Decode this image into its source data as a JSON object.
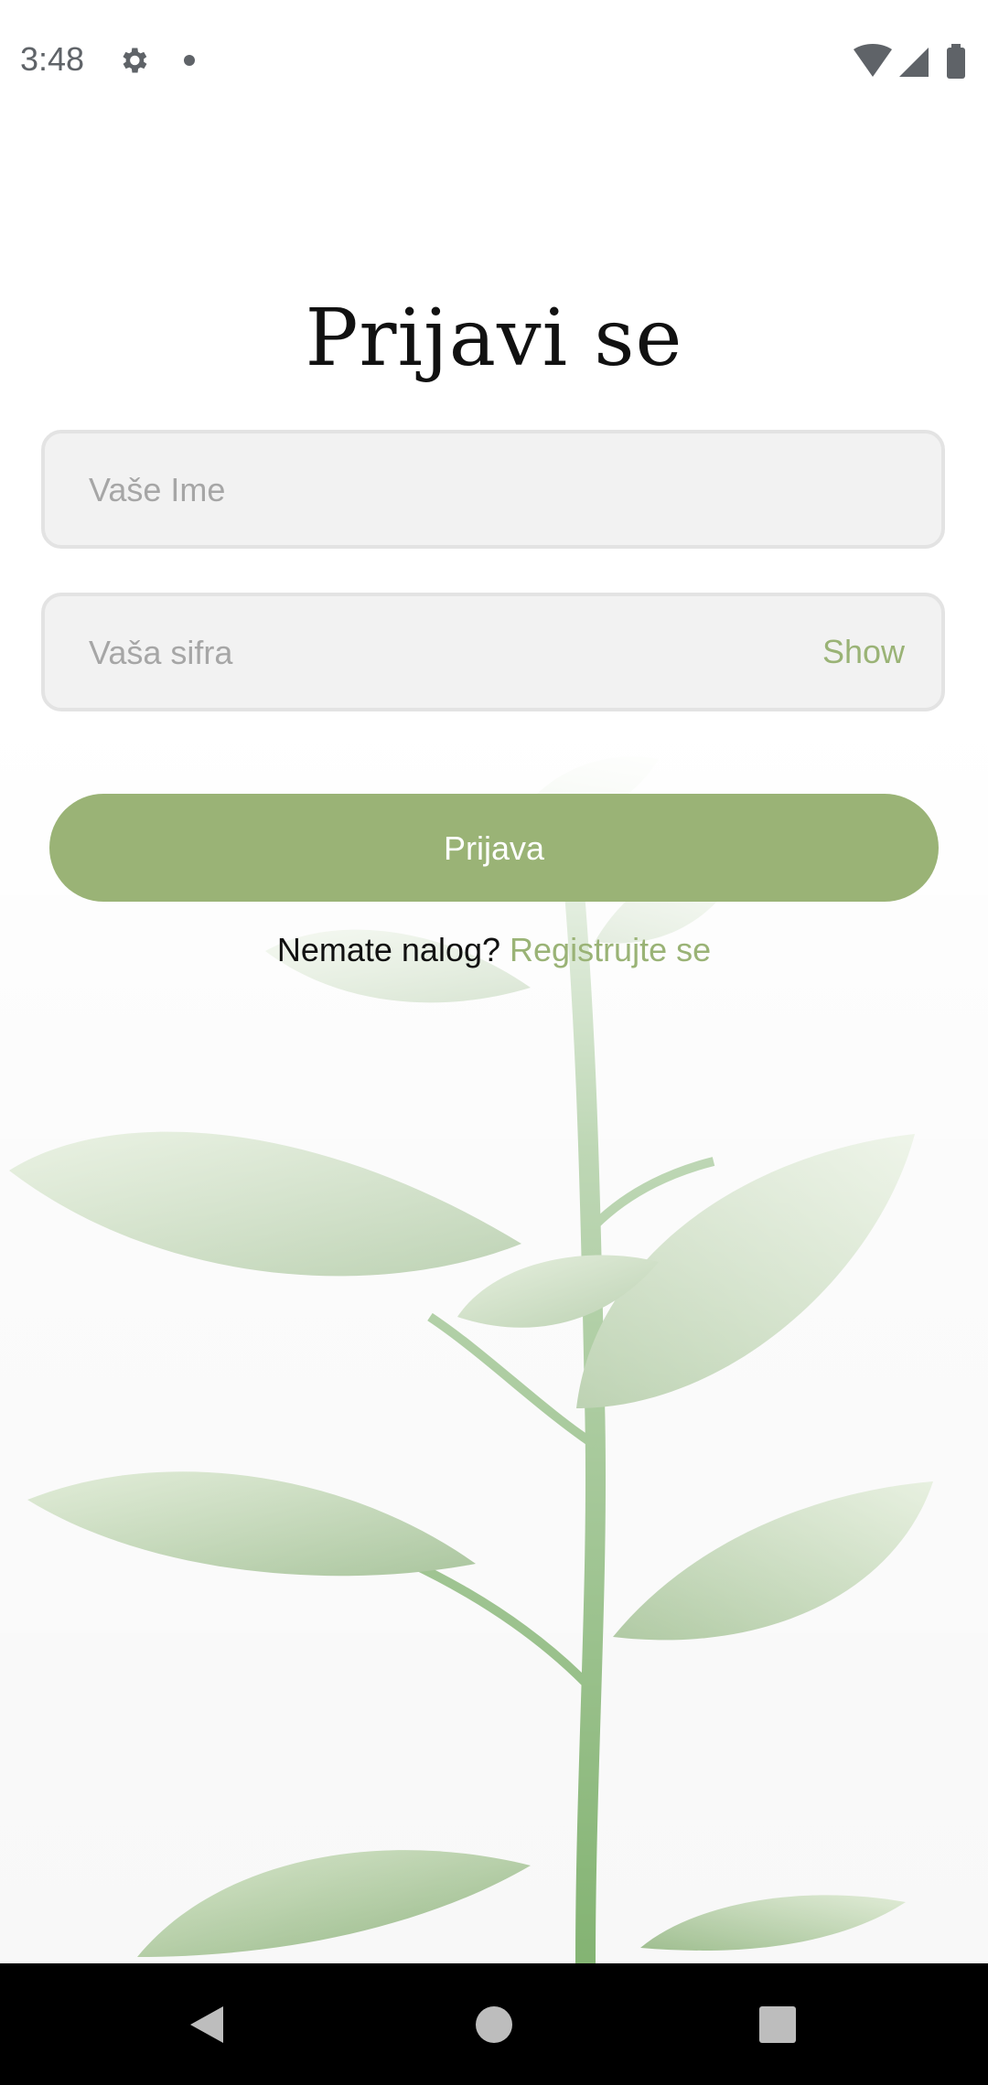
{
  "status_bar": {
    "time": "3:48",
    "icons": [
      "gear-icon",
      "notification-dot",
      "wifi-icon",
      "signal-icon",
      "battery-icon"
    ]
  },
  "login": {
    "title": "Prijavi se",
    "name_placeholder": "Vaše Ime",
    "password_placeholder": "Vaša sifra",
    "show_label": "Show",
    "submit_label": "Prijava",
    "no_account_text": "Nemate nalog?",
    "register_link": "Registrujte se"
  },
  "colors": {
    "accent": "#9ab376",
    "field_bg": "#f2f2f2",
    "field_border": "#e3e3e3"
  },
  "nav_bar": {
    "icons": [
      "back-icon",
      "home-icon",
      "recents-icon"
    ]
  }
}
